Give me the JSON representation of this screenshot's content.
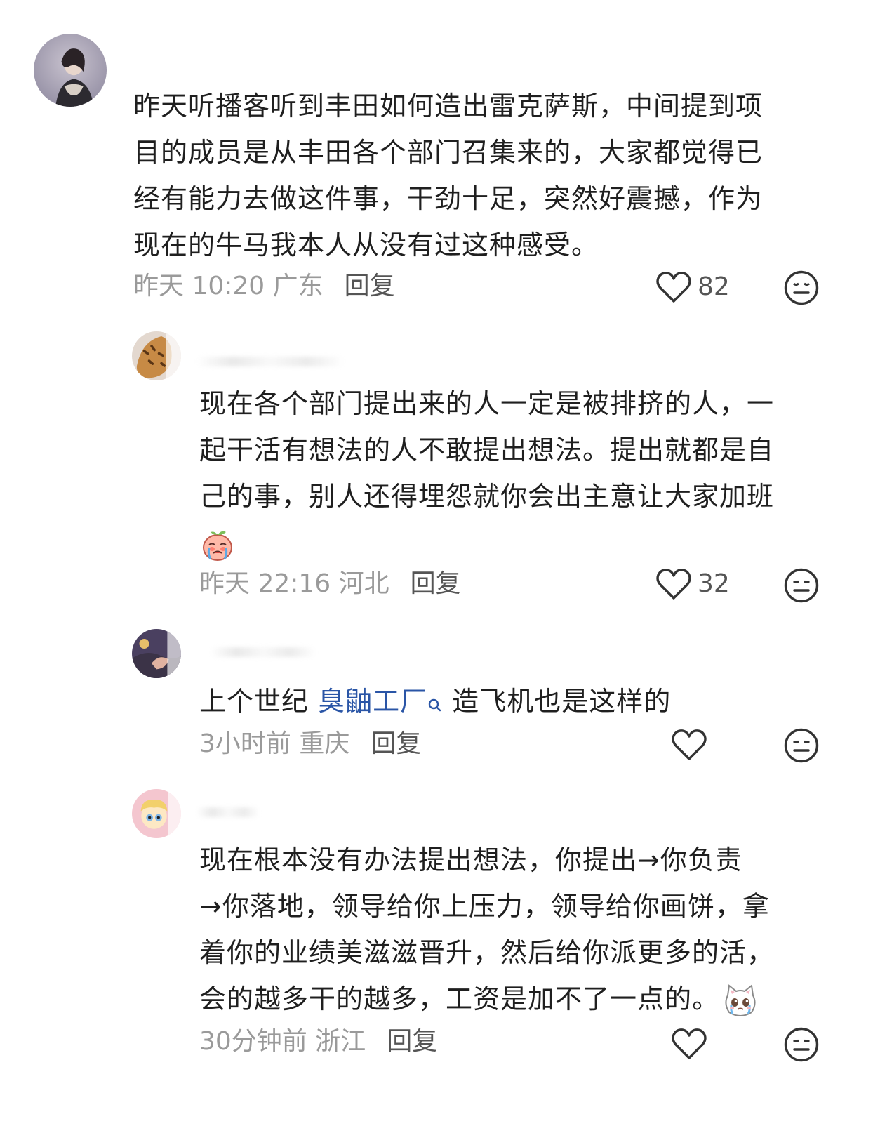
{
  "comments": [
    {
      "lines": [
        "昨天听播客听到丰田如何造出雷克萨斯，中间提到项",
        "目的成员是从丰田各个部门召集来的，大家都觉得已",
        "经有能力去做这件事，干劲十足，突然好震撼，作为",
        "现在的牛马我本人从没有过这种感受。"
      ],
      "time_location": "昨天 10:20 广东",
      "reply_label": "回复",
      "like_count": "82"
    },
    {
      "lines": [
        "现在各个部门提出来的人一定是被排挤的人，一",
        "起干活有想法的人不敢提出想法。提出就都是自",
        "己的事，别人还得埋怨就你会出主意让大家加班"
      ],
      "emoji": "crying-peach-emoji",
      "time_location": "昨天 22:16 河北",
      "reply_label": "回复",
      "like_count": "32"
    },
    {
      "text_before": "上个世纪 ",
      "link_text": "臭鼬工厂",
      "text_after": " 造飞机也是这样的",
      "time_location": "3小时前 重庆",
      "reply_label": "回复",
      "like_count": ""
    },
    {
      "lines": [
        "现在根本没有办法提出想法，你提出→你负责",
        "→你落地，领导给你上压力，领导给你画饼，拿",
        "着你的业绩美滋滋晋升，然后给你派更多的活，",
        "会的越多干的越多，工资是加不了一点的。"
      ],
      "emoji": "crying-cat-emoji",
      "time_location": "30分钟前 浙江",
      "reply_label": "回复",
      "like_count": ""
    }
  ],
  "icons": {
    "like": "heart-outline-icon",
    "dislike": "meh-face-icon",
    "search": "search-icon"
  },
  "colors": {
    "text": "#1f1f1f",
    "meta": "#9a9a9a",
    "reply": "#555555",
    "link": "#2a55a6"
  }
}
